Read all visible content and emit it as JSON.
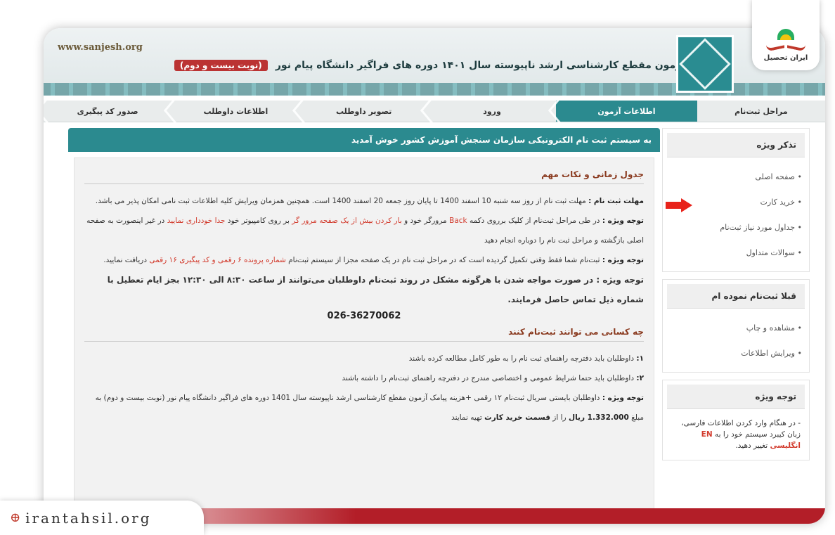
{
  "header": {
    "site_url": "www.sanjesh.org",
    "title": "آزمون مقطع کارشناسی ارشد ناپیوسته سال ۱۴۰۱ دوره های فراگیر دانشگاه پیام نور",
    "title_badge": "(نوبت بیست و دوم)"
  },
  "corner_logo": {
    "brand": "ایران تحصیل"
  },
  "nav": {
    "items": [
      {
        "label": "مراحل ثبت‌نام"
      },
      {
        "label": "اطلاعات آزمون"
      },
      {
        "label": "ورود"
      },
      {
        "label": "تصویر داوطلب"
      },
      {
        "label": "اطلاعات داوطلب"
      },
      {
        "label": "صدور کد پیگیری"
      }
    ],
    "active_index": 1
  },
  "main": {
    "welcome": "به سیستم ثبت نام الکترونیکی سازمان سنجش آموزش کشور خوش آمدید",
    "section1_title": "جدول زمانی و نکات مهم",
    "deadline_label": "مهلت ثبت نام :",
    "deadline_text": "مهلت ثبت نام از روز سه شنبه 10 اسفند 1400 تا پایان روز جمعه 20 اسفند 1400 است. همچنین همزمان ویرایش کلیه اطلاعات ثبت نامی امکان پذیر می باشد.",
    "note_label": "توجه ویژه :",
    "note1_a": "در طی مراحل ثبت‌نام از کلیک برروی دکمه",
    "note1_back": "Back",
    "note1_b": "مرورگر خود و",
    "note1_red": "بار کردن بیش از یک صفحه مرور گر",
    "note1_c": "بر روی کامپیوتر خود",
    "note1_red2": "جدا خودداری نمایید",
    "note1_d": "در غیر اینصورت به صفحه اصلی بازگشته و مراحل ثبت نام را دوباره انجام دهید",
    "note2_a": "ثبت‌نام شما فقط وقتی تکمیل گردیده است که در مراحل ثبت نام در یک صفحه مجزا از سیستم ثبت‌نام",
    "note2_red": "شماره پرونده ۶ رقمی و کد پیگیری ۱۶ رقمی",
    "note2_b": "دریافت نمایید.",
    "note3": "توجه ویژه : در صورت مواجه شدن با هرگونه مشکل در روند ثبت‌نام داوطلبان می‌توانند از ساعت ۸:۳۰ الی ۱۲:۳۰ بجز ایام تعطیل با شماره ذیل تماس حاصل فرمایند.",
    "phone": "026-36270062",
    "section2_title": "چه کسانی می توانند ثبت‌نام کنند",
    "item1_num": "۱:",
    "item1": "داوطلبان باید دفترچه راهنمای ثبت نام را به طور کامل مطالعه کرده باشند",
    "item2_num": "۲:",
    "item2": "داوطلبان باید حتما شرایط عمومی و اختصاصی مندرج در دفترچه راهنمای ثبت‌نام را داشته باشند",
    "note4_a": "داوطلبان بایستی سریال ثبت‌نام ۱۲ رقمی +هزینه پیامک آزمون مقطع کارشناسی ارشد ناپیوسته سال 1401 دوره های فراگیر دانشگاه پیام نور (نوبت بیست و دوم) به مبلغ",
    "note4_amount": "1.332.000 ریال",
    "note4_b": "را از",
    "note4_bold": "قسمت خرید کارت",
    "note4_c": "تهیه نمایند"
  },
  "sidebar": {
    "box1_title": "تذکر ویژه",
    "box1_items": [
      "صفحه اصلی",
      "خرید کارت",
      "جداول مورد نیاز ثبت‌نام",
      "سوالات متداول"
    ],
    "box2_title": "قبلا ثبت‌نام نموده ام",
    "box2_items": [
      "مشاهده و چاپ",
      "ویرایش اطلاعات"
    ],
    "box3_title": "توجه ویژه",
    "box3_note_a": "- در هنگام وارد کردن اطلاعات فارسی، زبان کیبرد سیستم خود را به",
    "box3_note_en": "EN انگلیسی",
    "box3_note_b": "تغییر دهید."
  },
  "footer": {
    "site": "irantahsil.org"
  },
  "colors": {
    "teal": "#2b8a8f",
    "red": "#d23b2d",
    "band": "#b31e28"
  }
}
